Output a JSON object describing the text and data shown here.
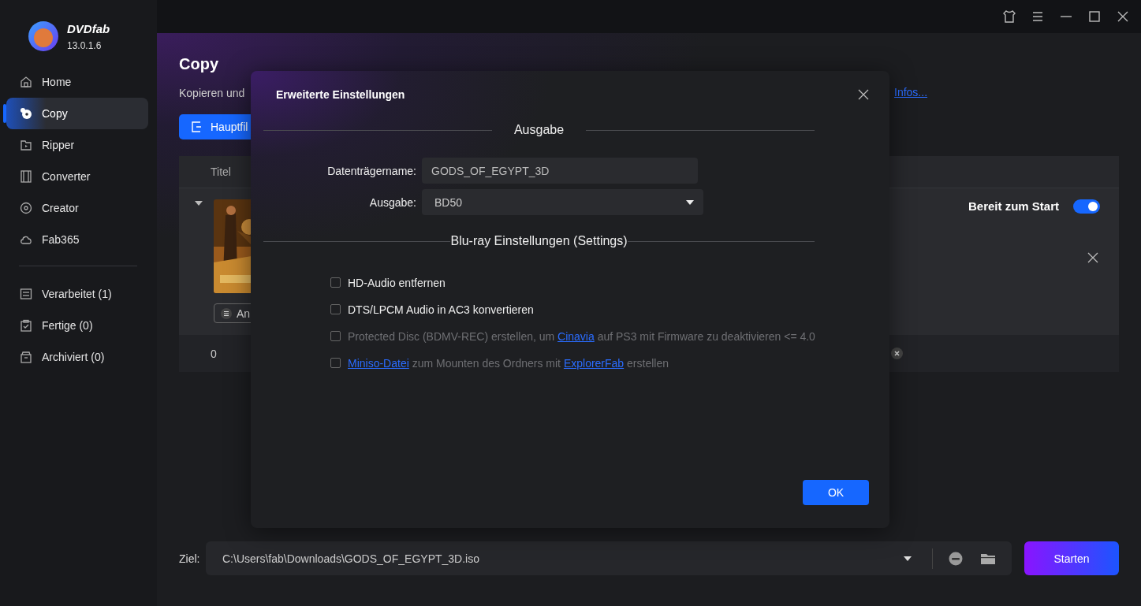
{
  "app": {
    "name": "DVDfab",
    "version": "13.0.1.6"
  },
  "sidebar": {
    "items": [
      {
        "label": "Home",
        "selected": false
      },
      {
        "label": "Copy",
        "selected": true
      },
      {
        "label": "Ripper",
        "selected": false
      },
      {
        "label": "Converter",
        "selected": false
      },
      {
        "label": "Creator",
        "selected": false
      },
      {
        "label": "Fab365",
        "selected": false
      }
    ],
    "queues": [
      {
        "label": "Verarbeitet (1)",
        "selected": false
      },
      {
        "label": "Fertige (0)",
        "selected": false
      },
      {
        "label": "Archiviert (0)",
        "selected": false
      }
    ]
  },
  "page": {
    "title": "Copy",
    "description": "Kopieren und",
    "more_link": "Infos...",
    "mode_button": "Hauptfil"
  },
  "table": {
    "columns": [
      "Titel"
    ],
    "rows": [
      {
        "expanded": true,
        "status": "Bereit zum Start",
        "on": true,
        "menu_button": "An"
      }
    ],
    "footer": {
      "count": "0"
    }
  },
  "output": {
    "label": "Ziel:",
    "path": "C:\\Users\\fab\\Downloads\\GODS_OF_EGYPT_3D.iso"
  },
  "start_button": "Starten",
  "dialog": {
    "title": "Erweiterte Einstellungen",
    "sections": [
      {
        "heading": "Ausgabe",
        "fields": [
          {
            "kind": "text",
            "label": "Datenträgername:",
            "value": "GODS_OF_EGYPT_3D"
          },
          {
            "kind": "select",
            "label": "Ausgabe:",
            "value": "BD50"
          }
        ]
      },
      {
        "heading": "Blu-ray Einstellungen (Settings)",
        "options": [
          {
            "checked": false,
            "disabled": false,
            "parts": [
              {
                "kind": "text",
                "text": "HD-Audio entfernen"
              }
            ]
          },
          {
            "checked": false,
            "disabled": false,
            "parts": [
              {
                "kind": "text",
                "text": "DTS/LPCM Audio in AC3 konvertieren"
              }
            ]
          },
          {
            "checked": false,
            "disabled": true,
            "parts": [
              {
                "kind": "text",
                "text": "Protected Disc (BDMV-REC) erstellen, um "
              },
              {
                "kind": "link",
                "text": "Cinavia"
              },
              {
                "kind": "text",
                "text": " auf PS3 mit Firmware zu deaktivieren <= 4.0"
              }
            ]
          },
          {
            "checked": false,
            "disabled": true,
            "parts": [
              {
                "kind": "link",
                "text": "Miniso-Datei"
              },
              {
                "kind": "text",
                "text": " zum Mounten des Ordners mit "
              },
              {
                "kind": "link",
                "text": "ExplorerFab"
              },
              {
                "kind": "text",
                "text": " erstellen"
              }
            ]
          }
        ]
      }
    ],
    "ok_button": "OK"
  }
}
